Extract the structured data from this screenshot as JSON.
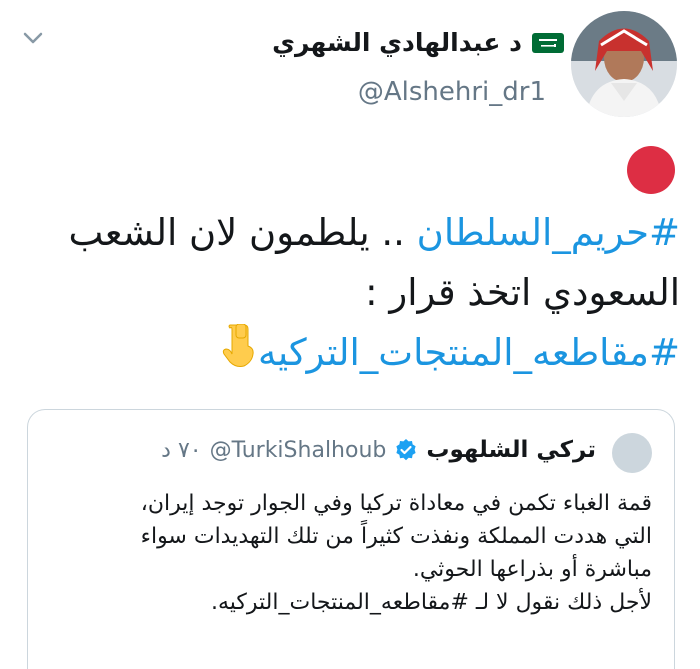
{
  "header": {
    "name": "د عبدالهادي الشهري",
    "handle": "@Alshehri_dr1"
  },
  "icons": {
    "flag": "saudi-flag-icon",
    "more": "chevron-down-icon",
    "verified": "verified-badge-icon",
    "emoji_red": "red-circle-emoji",
    "emoji_hand": "pointing-down-emoji"
  },
  "tweet": {
    "line1_hashtag": "#حريم_السلطان",
    "line1_text": " .. يلطمون لان الشعب",
    "line2_text": "السعودي اتخذ قرار :",
    "line3_hashtag": "#مقاطعه_المنتجات_التركيه"
  },
  "quote": {
    "name": "تركي الشلهوب",
    "handle": "@TurkiShalhoub",
    "time": "٧٠ د",
    "lines": [
      "قمة الغباء تكمن في معاداة تركيا وفي الجوار توجد إيران،",
      "التي هددت المملكة ونفذت كثيراً من تلك التهديدات سواء",
      "مباشرة أو بذراعها الحوثي.",
      "لأجل ذلك نقول لا لـ #مقاطعه_المنتجات_التركيه."
    ]
  },
  "colors": {
    "link": "#1b95e0",
    "secondary_text": "#657786",
    "red_circle": "#dd2e44",
    "border": "#ccd6dd"
  }
}
